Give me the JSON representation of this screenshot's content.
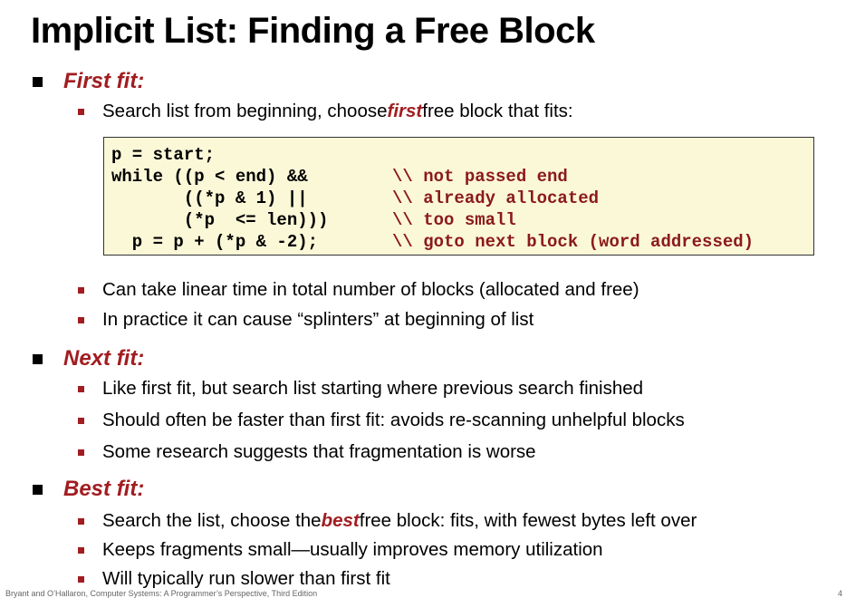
{
  "slide": {
    "title": "Implicit List: Finding a Free Block",
    "first_fit": {
      "heading": "First fit:",
      "intro_before": "Search list from beginning, choose ",
      "intro_emph": "first",
      "intro_after": " free block that fits:",
      "code": [
        {
          "code": "p = start;",
          "comment": ""
        },
        {
          "code": "while ((p < end) &&",
          "comment": "\\\\ not passed end"
        },
        {
          "code": "       ((*p & 1) ||",
          "comment": "\\\\ already allocated"
        },
        {
          "code": "       (*p  <= len)))",
          "comment": "\\\\ too small"
        },
        {
          "code": "  p = p + (*p & -2);",
          "comment": "\\\\ goto next block (word addressed)"
        }
      ],
      "points": [
        "Can take linear time in total number of blocks (allocated and free)",
        "In practice it can cause “splinters” at beginning of list"
      ]
    },
    "next_fit": {
      "heading": "Next fit:",
      "points": [
        "Like first fit, but search list starting where previous search finished",
        "Should often be faster than first fit: avoids re-scanning unhelpful blocks",
        "Some research suggests that fragmentation is worse"
      ]
    },
    "best_fit": {
      "heading": "Best fit:",
      "first_before": "Search the list, choose the ",
      "first_emph": "best",
      "first_after": " free block: fits, with fewest bytes left over",
      "points": [
        "Keeps fragments small—usually improves memory utilization",
        "Will typically run slower than first fit"
      ]
    },
    "footer": "Bryant and O’Hallaron, Computer Systems: A Programmer’s Perspective, Third Edition",
    "page_number": "4"
  },
  "colors": {
    "accent": "#a11d21",
    "code_background": "#fbf8d8",
    "code_comment": "#8b1a1a"
  }
}
